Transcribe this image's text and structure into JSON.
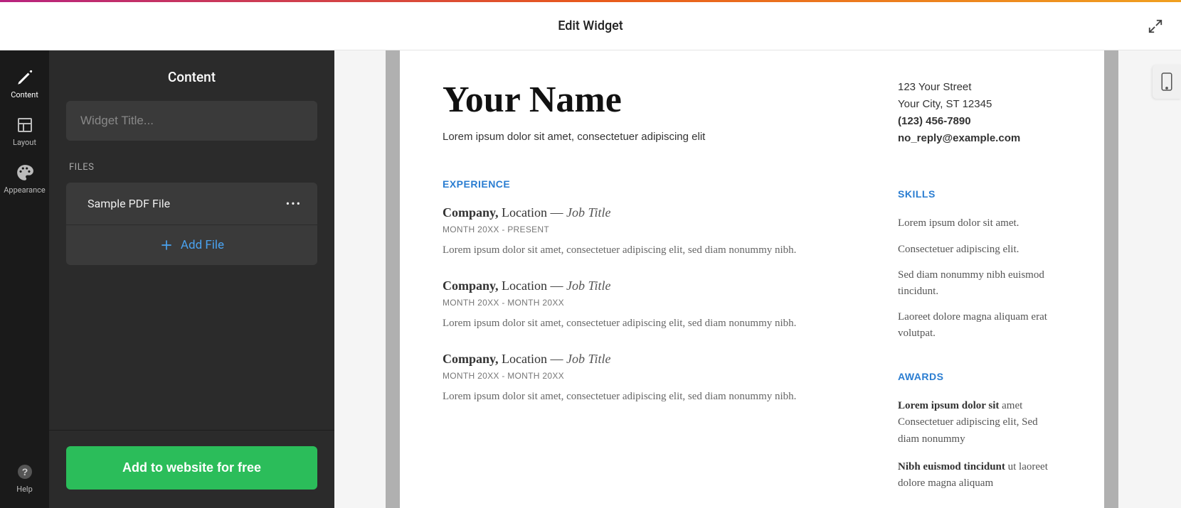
{
  "header": {
    "title": "Edit Widget"
  },
  "rail": {
    "content": "Content",
    "layout": "Layout",
    "appearance": "Appearance",
    "help": "Help"
  },
  "panel": {
    "title": "Content",
    "title_placeholder": "Widget Title...",
    "files_label": "FILES",
    "file_name": "Sample PDF File",
    "add_file": "Add File",
    "add_website": "Add to website for free"
  },
  "resume": {
    "name": "Your Name",
    "tagline": "Lorem ipsum dolor sit amet, consectetuer adipiscing elit",
    "contact": {
      "street": "123 Your Street",
      "city": "Your City, ST 12345",
      "phone": "(123) 456-7890",
      "email": "no_reply@example.com"
    },
    "experience_h": "EXPERIENCE",
    "skills_h": "SKILLS",
    "awards_h": "AWARDS",
    "jobs": [
      {
        "company": "Company,",
        "location": "Location —",
        "title": "Job Title",
        "date": "MONTH 20XX - PRESENT",
        "desc": "Lorem ipsum dolor sit amet, consectetuer adipiscing elit, sed diam nonummy nibh."
      },
      {
        "company": "Company,",
        "location": "Location —",
        "title": "Job Title",
        "date": "MONTH 20XX - MONTH 20XX",
        "desc": "Lorem ipsum dolor sit amet, consectetuer adipiscing elit, sed diam nonummy nibh."
      },
      {
        "company": "Company,",
        "location": "Location —",
        "title": "Job Title",
        "date": "MONTH 20XX - MONTH 20XX",
        "desc": "Lorem ipsum dolor sit amet, consectetuer adipiscing elit, sed diam nonummy nibh."
      }
    ],
    "skills": [
      "Lorem ipsum dolor sit amet.",
      "Consectetuer adipiscing elit.",
      "Sed diam nonummy nibh euismod tincidunt.",
      "Laoreet dolore magna aliquam erat volutpat."
    ],
    "awards": [
      {
        "bold": "Lorem ipsum dolor sit",
        "rest": " amet Consectetuer adipiscing elit, Sed diam nonummy"
      },
      {
        "bold": "Nibh euismod tincidunt",
        "rest": " ut laoreet dolore magna aliquam"
      }
    ]
  }
}
